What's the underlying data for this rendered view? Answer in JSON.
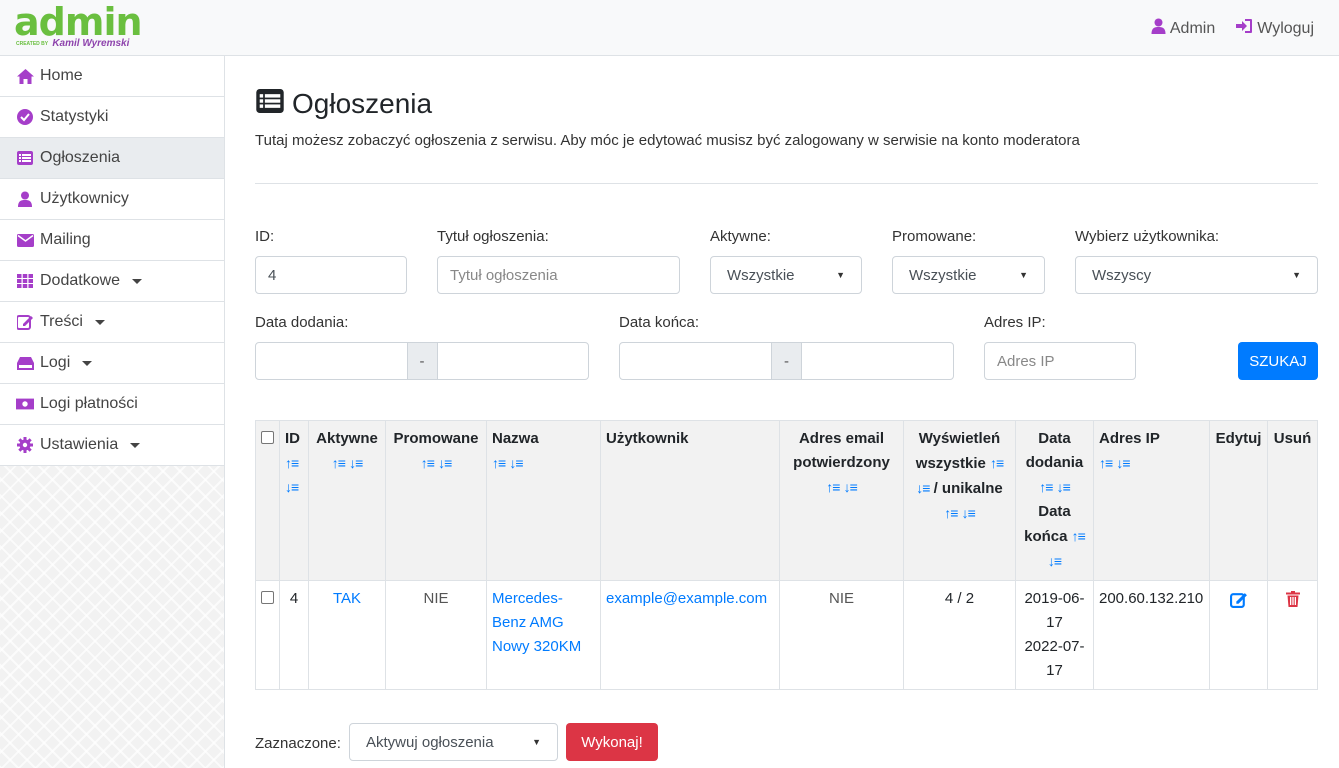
{
  "brand": {
    "name": "admin",
    "created_by": "CREATED BY",
    "author": "Kamil Wyremski"
  },
  "topnav": {
    "user": "Admin",
    "logout": "Wyloguj"
  },
  "sidebar": {
    "items": [
      {
        "label": "Home",
        "icon": "home-icon"
      },
      {
        "label": "Statystyki",
        "icon": "check-circle-icon"
      },
      {
        "label": "Ogłoszenia",
        "icon": "list-icon",
        "active": true
      },
      {
        "label": "Użytkownicy",
        "icon": "user-icon"
      },
      {
        "label": "Mailing",
        "icon": "envelope-icon"
      },
      {
        "label": "Dodatkowe",
        "icon": "grid-icon",
        "dropdown": true
      },
      {
        "label": "Treści",
        "icon": "edit-icon",
        "dropdown": true
      },
      {
        "label": "Logi",
        "icon": "hdd-icon",
        "dropdown": true
      },
      {
        "label": "Logi płatności",
        "icon": "money-icon"
      },
      {
        "label": "Ustawienia",
        "icon": "cog-icon",
        "dropdown": true
      }
    ]
  },
  "page": {
    "title": "Ogłoszenia",
    "description": "Tutaj możesz zobaczyć ogłoszenia z serwisu. Aby móc je edytować musisz być zalogowany w serwisie na konto moderatora"
  },
  "filters": {
    "id": {
      "label": "ID:",
      "value": "4"
    },
    "title": {
      "label": "Tytuł ogłoszenia:",
      "placeholder": "Tytuł ogłoszenia"
    },
    "active": {
      "label": "Aktywne:",
      "value": "Wszystkie"
    },
    "promoted": {
      "label": "Promowane:",
      "value": "Wszystkie"
    },
    "user": {
      "label": "Wybierz użytkownika:",
      "value": "Wszyscy"
    },
    "date_added": {
      "label": "Data dodania:",
      "separator": "-"
    },
    "date_end": {
      "label": "Data końca:",
      "separator": "-"
    },
    "ip": {
      "label": "Adres IP:",
      "placeholder": "Adres IP"
    },
    "search_button": "SZUKAJ"
  },
  "table": {
    "headers": {
      "id": "ID",
      "active": "Aktywne",
      "promoted": "Promowane",
      "name": "Nazwa",
      "user": "Użytkownik",
      "email_confirmed": "Adres email potwierdzony",
      "views_all": "Wyświetleń wszystkie",
      "views_unique": "/ unikalne",
      "date_added": "Data dodania",
      "date_end": "Data końca",
      "ip": "Adres IP",
      "edit": "Edytuj",
      "delete": "Usuń"
    },
    "rows": [
      {
        "id": "4",
        "active": "TAK",
        "promoted": "NIE",
        "name": "Mercedes-Benz AMG Nowy 320KM",
        "user": "example@example.com",
        "email_confirmed": "NIE",
        "views": "4 / 2",
        "date_added": "2019-06-17",
        "date_end": "2022-07-17",
        "ip": "200.60.132.210"
      }
    ]
  },
  "bulk": {
    "label": "Zaznaczone:",
    "action": "Aktywuj ogłoszenia",
    "submit": "Wykonaj!"
  },
  "colors": {
    "primary": "#007bff",
    "danger": "#dc3545",
    "brand_green": "#6abf3f",
    "brand_purple": "#8e44ad",
    "icon_purple": "#a53ec9"
  }
}
